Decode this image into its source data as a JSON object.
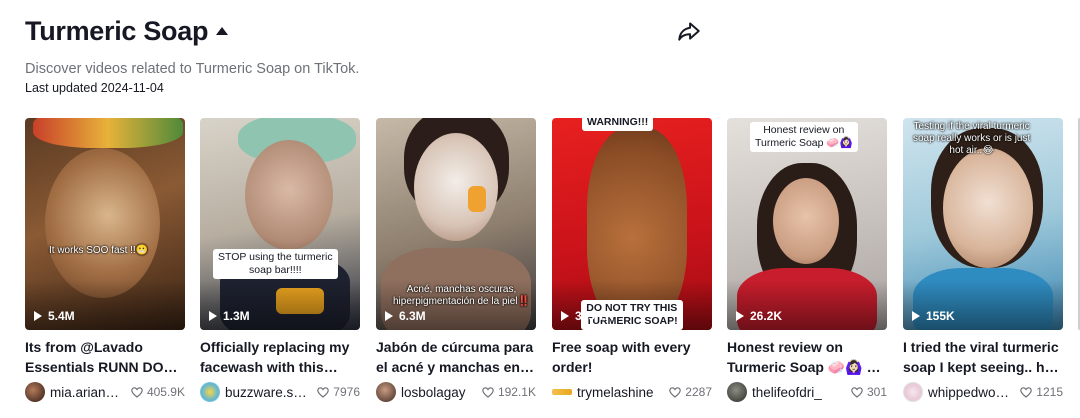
{
  "header": {
    "title": "Turmeric Soap",
    "description": "Discover videos related to Turmeric Soap on TikTok.",
    "last_updated": "Last updated 2024-11-04"
  },
  "icons": {
    "title_caret": "caret-up-icon",
    "share": "share-arrow-icon",
    "play": "play-icon",
    "like": "heart-icon"
  },
  "colors": {
    "text": "#161823",
    "muted": "#6f7178",
    "warning_red": "#e3171b"
  },
  "videos": [
    {
      "overlay": "It works SOO fast !!😬",
      "plays": "5.4M",
      "caption1": "Its from @Lavado",
      "caption2": "Essentials RUNN DON…",
      "user": "mia.arian…",
      "likes": "405.9K"
    },
    {
      "overlay": "STOP using the turmeric\nsoap bar!!!!",
      "plays": "1.3M",
      "caption1": "Officially replacing my",
      "caption2": "facewash with this…",
      "user": "buzzware.s…",
      "likes": "7976"
    },
    {
      "overlay": "Acné, manchas oscuras,\nhiperpigmentación de la piel‼️",
      "plays": "6.3M",
      "caption1": "Jabón de cúrcuma para",
      "caption2": "el acné y manchas en l…",
      "user": "losbolagay",
      "likes": "192.1K"
    },
    {
      "overlay_top": "WARNING!!!",
      "overlay": "DO NOT TRY THIS\nTURMERIC SOAP!",
      "plays": "349.7K",
      "caption1": "Free soap with every",
      "caption2": "order!",
      "user": "trymelashine",
      "likes": "2287"
    },
    {
      "overlay": "Honest review on\nTurmeric Soap 🧼🙆🏻‍♀️",
      "plays": "26.2K",
      "caption1": "Honest review on",
      "caption2": "Turmeric Soap 🧼🙆🏻‍♀️ S…",
      "user": "thelifeofdri_",
      "likes": "301"
    },
    {
      "overlay": "Testing if the viral turmeric\nsoap really works or is just\nhot air..😂",
      "plays": "155K",
      "caption1": "I tried the viral turmeric",
      "caption2": "soap I kept seeing.. he…",
      "user": "whippedwo…",
      "likes": "1215"
    }
  ]
}
